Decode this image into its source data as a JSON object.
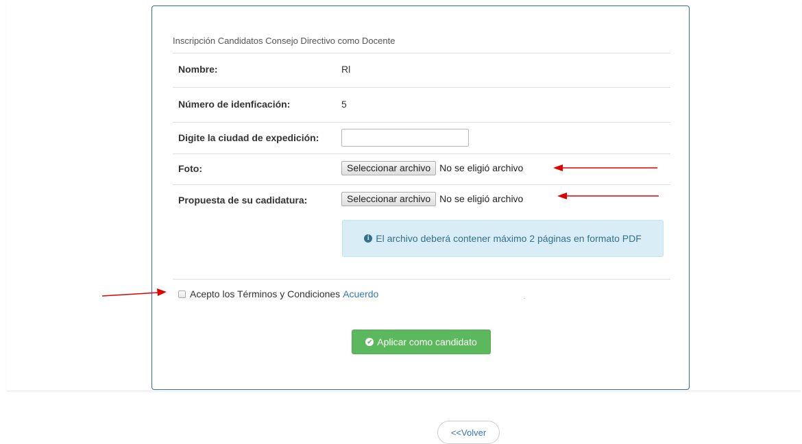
{
  "form": {
    "title": "Inscripción Candidatos Consejo Directivo como Docente",
    "nombre_label": "Nombre:",
    "nombre_value": "Rl",
    "id_label": "Número de idenficación:",
    "id_value": "5",
    "ciudad_label": "Digite la ciudad de expedición:",
    "ciudad_value": "",
    "foto_label": "Foto:",
    "foto_button": "Seleccionar archivo",
    "foto_status": "No se eligió archivo",
    "propuesta_label": "Propuesta de su cadidatura:",
    "propuesta_button": "Seleccionar archivo",
    "propuesta_status": "No se eligió archivo",
    "info_text": "El archivo deberá contener máximo 2 páginas en formato PDF",
    "terms_text": "Acepto los Términos y Condiciones",
    "terms_link": "Acuerdo",
    "apply_button": "Aplicar como candidato",
    "back_button": "<<Volver"
  },
  "icons": {
    "info": "info-circle-icon",
    "apply": "check-circle-icon"
  },
  "colors": {
    "panel_border": "#2e6da4",
    "info_bg": "#d9edf7",
    "info_text": "#31708f",
    "success": "#5cb85c",
    "link": "#337ab7",
    "annotation_arrow": "#e00000"
  }
}
